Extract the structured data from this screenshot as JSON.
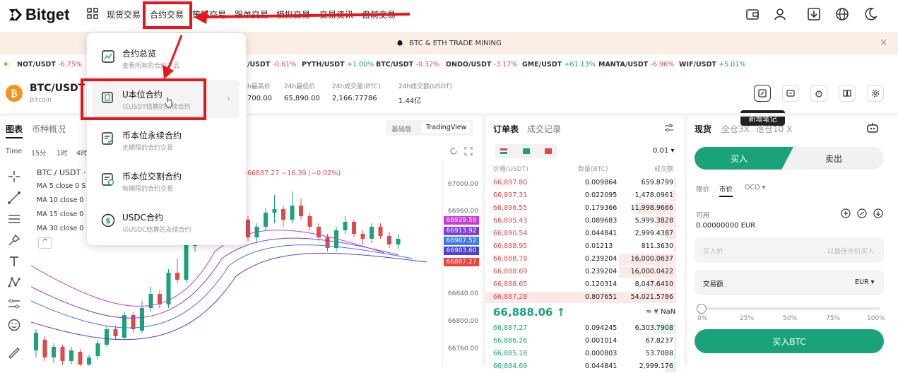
{
  "app": {
    "logo_text": "Bitget"
  },
  "nav": {
    "items": [
      "现货交易",
      "合约交易",
      "策略交易",
      "跟单交易",
      "模拟交易",
      "交易资讯",
      "盘前交易"
    ]
  },
  "banner": {
    "text": "BTC & ETH TRADE MINING",
    "close": "×"
  },
  "ticker": [
    {
      "pair": "NOT/USDT",
      "change": "-6.75%",
      "dir": "neg"
    },
    {
      "pair": "/USDT",
      "change": "-0.61%",
      "dir": "neg"
    },
    {
      "pair": "PYTH/USDT",
      "change": "+1.00%",
      "dir": "pos"
    },
    {
      "pair": "BTC/USDT",
      "change": "-0.32%",
      "dir": "neg"
    },
    {
      "pair": "ONDO/USDT",
      "change": "-3.17%",
      "dir": "neg"
    },
    {
      "pair": "GME/USDT",
      "change": "+61.13%",
      "dir": "pos"
    },
    {
      "pair": "MANTA/USDT",
      "change": "-6.96%",
      "dir": "neg"
    },
    {
      "pair": "WIF/USDT",
      "change": "+5.01%",
      "dir": "pos"
    }
  ],
  "pair": {
    "symbol": "BTC/USDT",
    "name": "Bitcoin",
    "stats": [
      {
        "label": "h最高价",
        "value": "700.00"
      },
      {
        "label": "24h最低价",
        "value": "65,890.00"
      },
      {
        "label": "24h成交量(BTC)",
        "value": "2,166.77786"
      },
      {
        "label": "24h成交额(USDT)",
        "value": "1.44亿"
      }
    ],
    "tooltip": "新增笔记"
  },
  "chart": {
    "tabs": [
      "图表",
      "币种概况"
    ],
    "views": [
      "基础版",
      "TradingView"
    ],
    "intervals": [
      "Time",
      "15分",
      "1时",
      "4时"
    ],
    "title": "BTC / USDT ·",
    "ohlc": "=66887.27  −16.39 (−0.02%)",
    "ma": [
      "MA 5 close 0 S",
      "MA 10 close 0",
      "MA 15 close 0",
      "MA 30 close 0"
    ],
    "collapse": "^",
    "y_labels": [
      "67000.00",
      "66960.00",
      "66840.00",
      "66800.00",
      "66760.00"
    ],
    "price_tags": [
      {
        "value": "66929.59",
        "color": "#c93bd8"
      },
      {
        "value": "66913.92",
        "color": "#7e3fd8"
      },
      {
        "value": "66907.52",
        "color": "#3f7be0"
      },
      {
        "value": "66903.60",
        "color": "#4a3fd8"
      },
      {
        "value": "66887.27",
        "color": "#f0413a"
      }
    ]
  },
  "orderbook": {
    "tabs": [
      "订单表",
      "成交记录"
    ],
    "precision": "0.01",
    "headers": [
      "价格(USDT)",
      "数量(BTC)",
      "成交额"
    ],
    "asks": [
      [
        "66,897.80",
        "0.009864",
        "659.8799"
      ],
      [
        "66,897.31",
        "0.022095",
        "1,478.0961"
      ],
      [
        "66,896.55",
        "0.179366",
        "11,998.9666"
      ],
      [
        "66,895.43",
        "0.089683",
        "5,999.3828"
      ],
      [
        "66,890.54",
        "0.044841",
        "2,999.4387"
      ],
      [
        "66,888.95",
        "0.01213",
        "811.3630"
      ],
      [
        "66,888.78",
        "0.239204",
        "16,000.0637"
      ],
      [
        "66,888.69",
        "0.239204",
        "16,000.0422"
      ],
      [
        "66,888.65",
        "0.120314",
        "8,047.6410"
      ],
      [
        "66,887.28",
        "0.807651",
        "54,021.5786"
      ]
    ],
    "ask_depth": [
      0.01,
      0.03,
      0.22,
      0.11,
      0.06,
      0.02,
      0.3,
      0.3,
      0.15,
      1.0
    ],
    "mid_price": "66,888.06 ↑",
    "mid_fiat": "≈ ¥ NaN",
    "bids": [
      [
        "66,887.27",
        "0.094245",
        "6,303.7908"
      ],
      [
        "66,886.26",
        "0.001014",
        "67.8237"
      ],
      [
        "66,885.18",
        "0.000803",
        "53.7088"
      ],
      [
        "66,884.69",
        "0.044841",
        "2,999.176"
      ]
    ],
    "bid_depth": [
      0.12,
      0.01,
      0.01,
      0.06
    ]
  },
  "trade": {
    "tabs": [
      "现货",
      "全仓3X",
      "逐仓10 X"
    ],
    "buy": "买入",
    "sell": "卖出",
    "order_types": [
      "限价",
      "市价",
      "OCO ▾"
    ],
    "available_label": "可用",
    "available_value": "0.00000000 EUR",
    "price_placeholder": "买入价",
    "price_hint": "以最佳市价买入",
    "amount_label": "交易额",
    "currency": "EUR ▾",
    "slider": [
      "0%",
      "25%",
      "50%",
      "75%",
      "100%"
    ],
    "slider_level": 0,
    "submit": "买入BTC"
  },
  "dropdown": {
    "items": [
      {
        "title": "合约总览",
        "sub": "查看所有的合约产品"
      },
      {
        "title": "U本位合约",
        "sub": "以USDT结算的永续合约"
      },
      {
        "title": "币本位永续合约",
        "sub": "无期限的合约交易"
      },
      {
        "title": "币本位交割合约",
        "sub": "有期限的合约交易"
      },
      {
        "title": "USDC合约",
        "sub": "以USDC结算的永续合约"
      }
    ]
  },
  "colors": {
    "green": "#1aa37a",
    "red": "#e0494a",
    "annotation": "#e8161b",
    "banner_bg": "#fbeee5"
  }
}
